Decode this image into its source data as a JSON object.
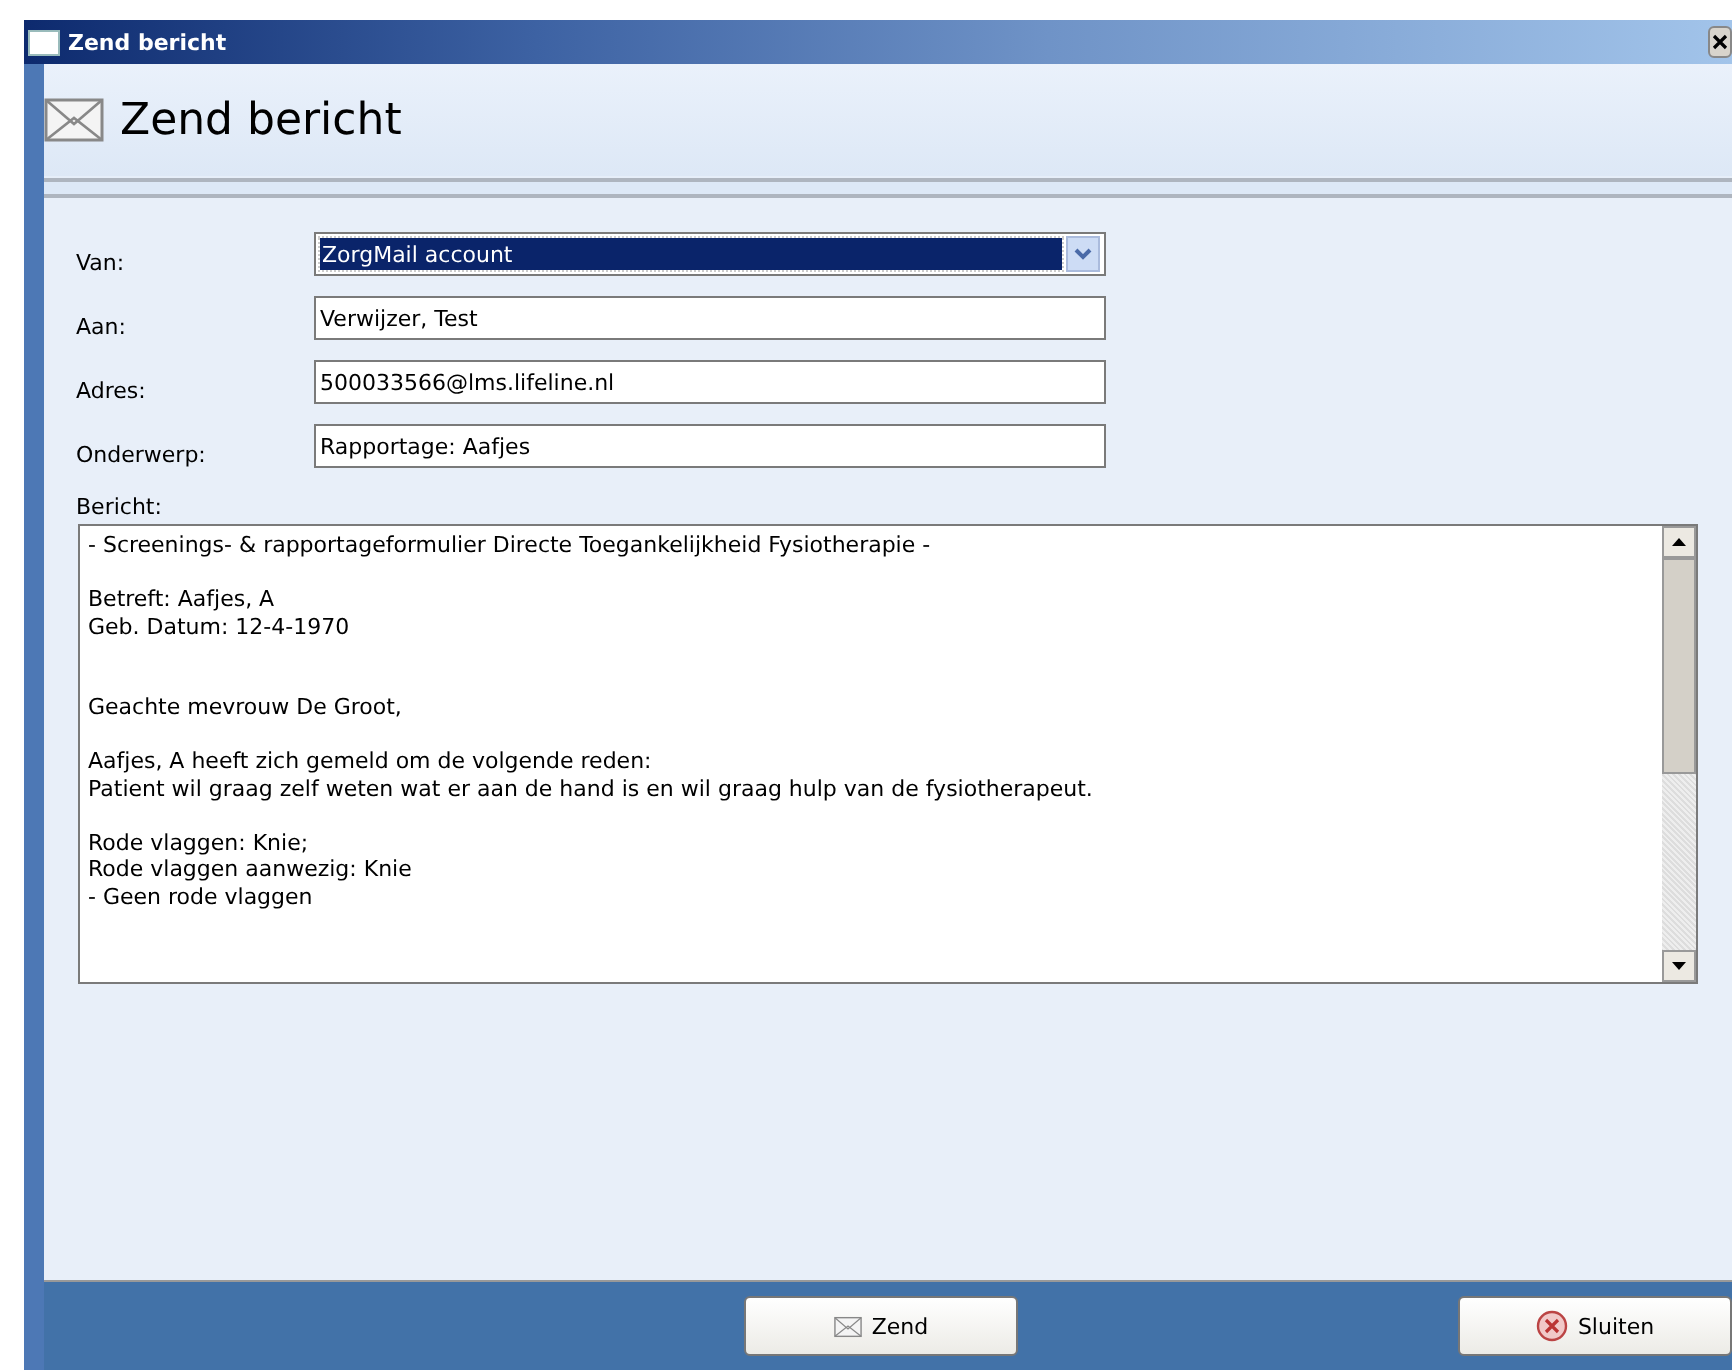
{
  "window": {
    "title": "Zend bericht"
  },
  "header": {
    "title": "Zend bericht"
  },
  "fields": [
    {
      "kind": "dropdown",
      "label": "Van:",
      "value": "ZorgMail account",
      "selected": true
    },
    {
      "kind": "text",
      "label": "Aan:",
      "value": "Verwijzer, Test"
    },
    {
      "kind": "text",
      "label": "Adres:",
      "value": "500033566@lms.lifeline.nl"
    },
    {
      "kind": "text",
      "label": "Onderwerp:",
      "value": "Rapportage: Aafjes"
    }
  ],
  "message": {
    "label": "Bericht:",
    "value": "- Screenings- & rapportageformulier Directe Toegankelijkheid Fysiotherapie -\n\nBetreft: Aafjes, A\nGeb. Datum: 12-4-1970\n\n\nGeachte mevrouw De Groot,\n\nAafjes, A heeft zich gemeld om de volgende reden:\nPatient wil graag zelf weten wat er aan de hand is en wil graag hulp van de fysiotherapeut.\n\nRode vlaggen: Knie;\nRode vlaggen aanwezig: Knie\n- Geen rode vlaggen"
  },
  "buttons": [
    {
      "kind": "send",
      "label": "Zend"
    },
    {
      "kind": "close",
      "label": "Sluiten"
    }
  ]
}
